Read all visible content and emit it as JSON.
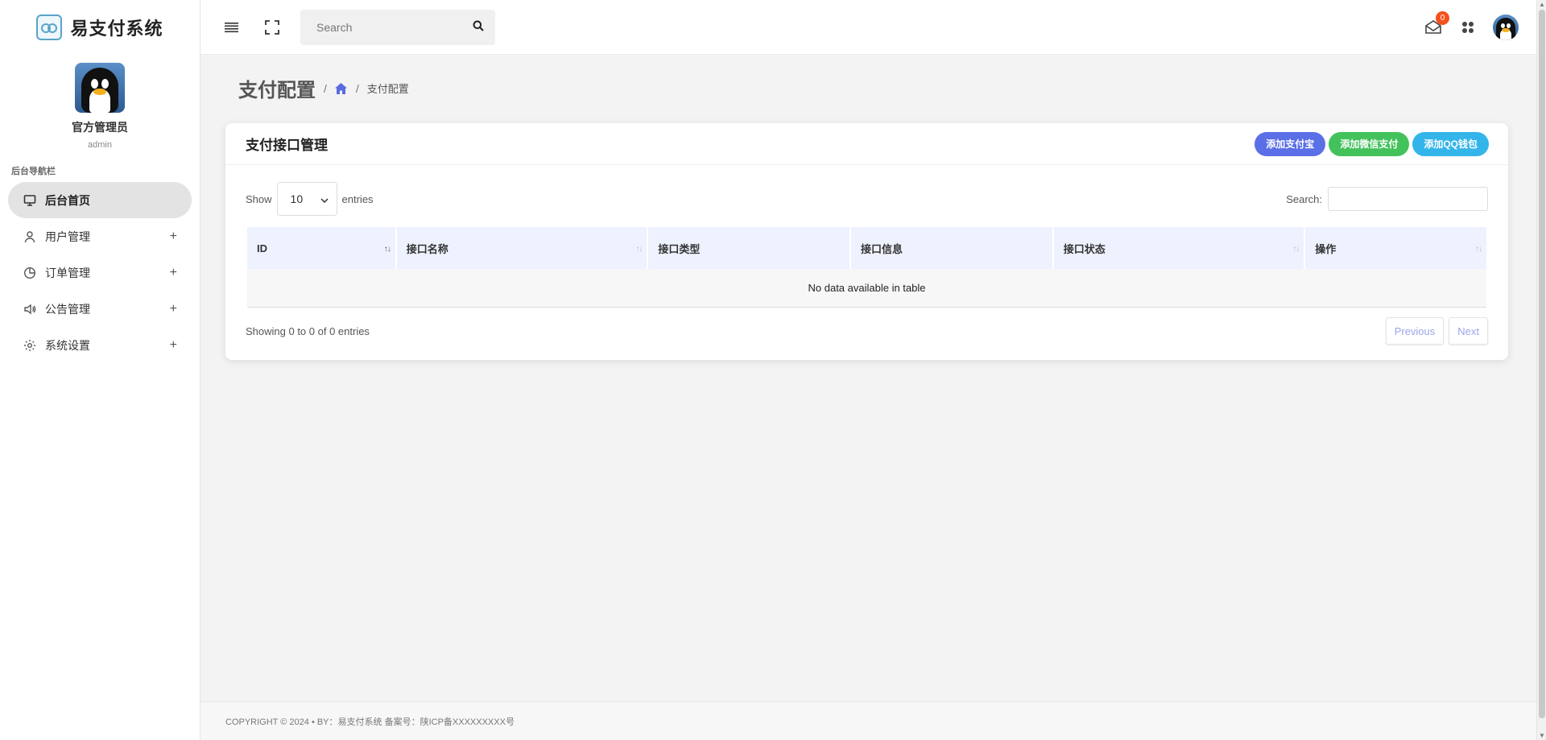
{
  "app": {
    "title": "易支付系统"
  },
  "profile": {
    "name": "官方管理员",
    "role": "admin"
  },
  "nav": {
    "heading": "后台导航栏",
    "items": [
      {
        "label": "后台首页",
        "icon": "monitor-icon",
        "active": true
      },
      {
        "label": "用户管理",
        "icon": "user-icon",
        "expand": "+"
      },
      {
        "label": "订单管理",
        "icon": "pie-chart-icon",
        "expand": "+"
      },
      {
        "label": "公告管理",
        "icon": "speaker-icon",
        "expand": "+"
      },
      {
        "label": "系统设置",
        "icon": "gear-icon",
        "expand": "+"
      }
    ]
  },
  "topbar": {
    "search_placeholder": "Search",
    "notification_count": "0"
  },
  "page": {
    "title": "支付配置",
    "breadcrumb_sep": "/",
    "breadcrumb_current": "支付配置"
  },
  "card": {
    "title": "支付接口管理",
    "buttons": {
      "alipay": "添加支付宝",
      "wechat": "添加微信支付",
      "qq": "添加QQ钱包"
    },
    "show_label": "Show",
    "page_length": "10",
    "entries_label": "entries",
    "search_label": "Search:",
    "columns": [
      "ID",
      "接口名称",
      "接口类型",
      "接口信息",
      "接口状态",
      "操作"
    ],
    "empty_text": "No data available in table",
    "info": "Showing 0 to 0 of 0 entries",
    "prev": "Previous",
    "next": "Next"
  },
  "footer": {
    "text": "COPYRIGHT © 2024 • BY：易支付系统     备案号：陕ICP备XXXXXXXXX号"
  },
  "colors": {
    "accent": "#5b6fe6",
    "wechat": "#43c25b",
    "qq": "#33b5ea",
    "badge": "#f4511e"
  }
}
